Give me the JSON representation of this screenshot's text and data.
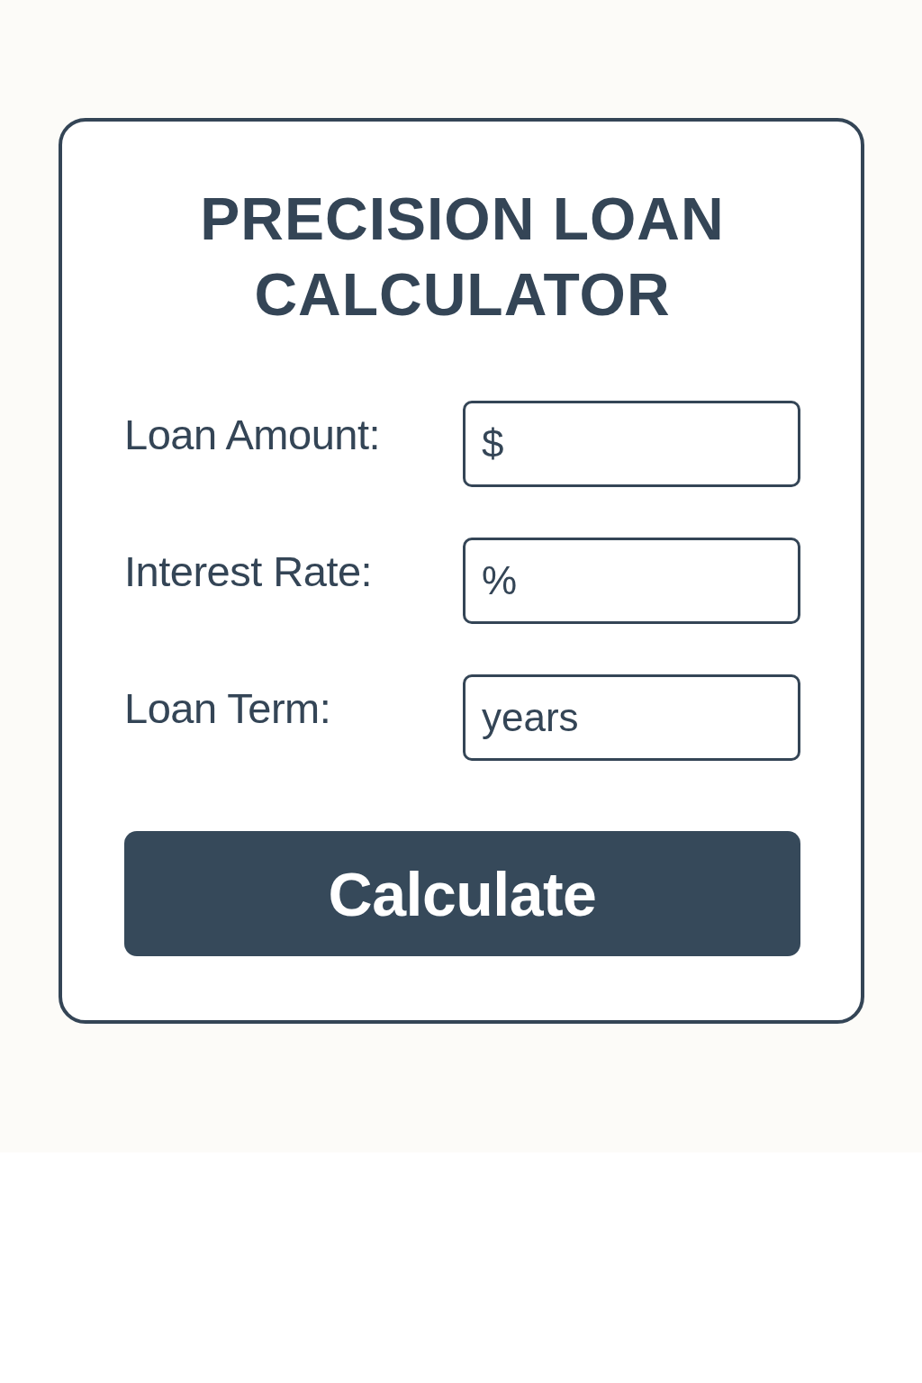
{
  "title": "PRECISION LOAN CALCULATOR",
  "fields": [
    {
      "label": "Loan Amount:",
      "placeholder": "$"
    },
    {
      "label": "Interest Rate:",
      "placeholder": "%"
    },
    {
      "label": "Loan Term:",
      "placeholder": "years"
    }
  ],
  "button": "Calculate"
}
